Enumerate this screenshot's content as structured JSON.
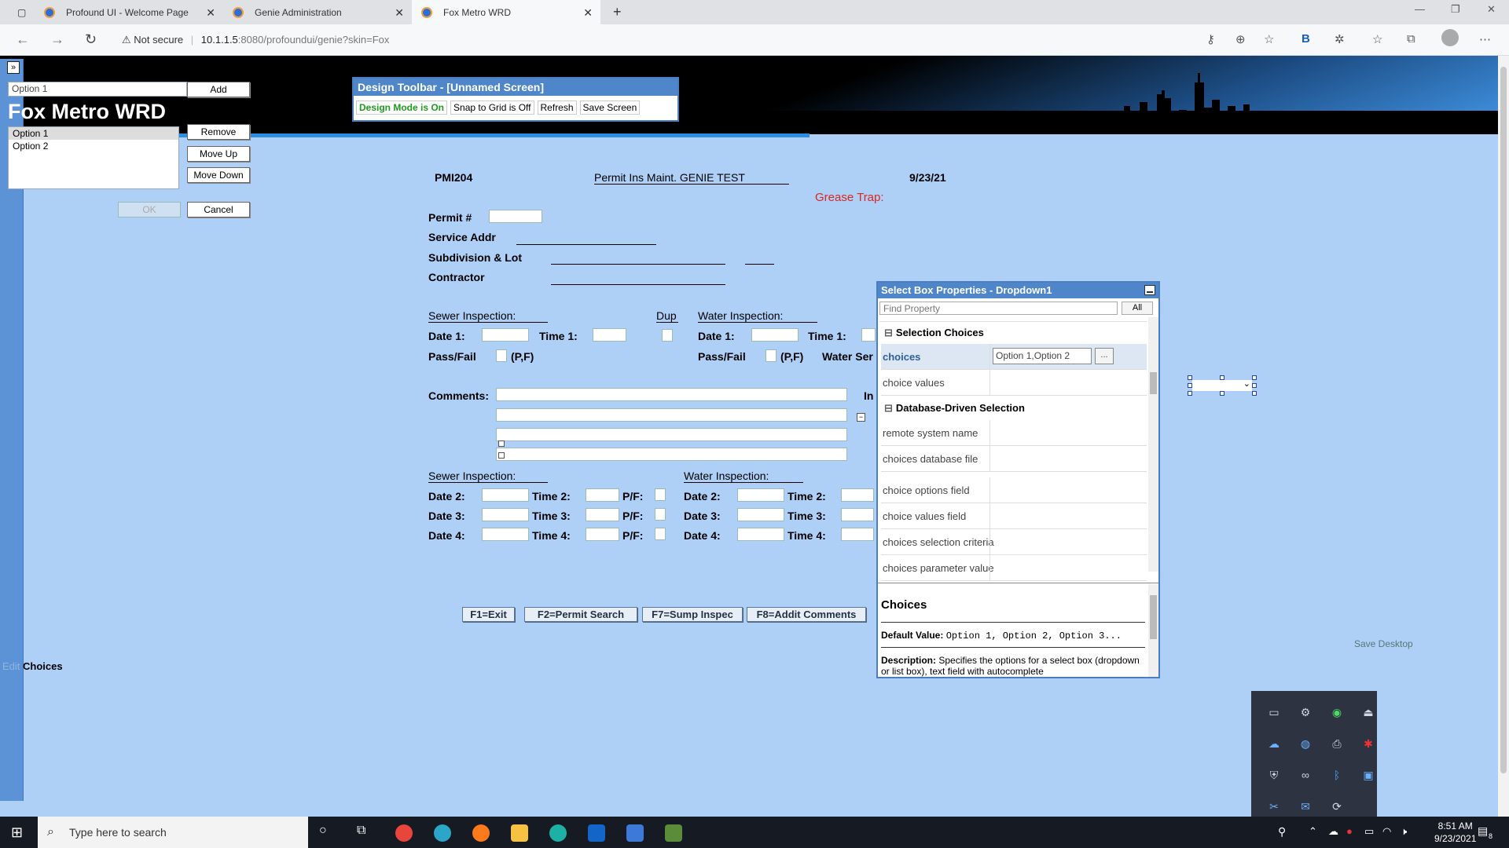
{
  "browser": {
    "tabs": [
      {
        "title": "Profound UI - Welcome Page"
      },
      {
        "title": "Genie Administration"
      },
      {
        "title": "Fox Metro WRD"
      }
    ],
    "new_tab": "+",
    "security": "Not secure",
    "url_host": "10.1.1.5",
    "url_path": ":8080/profoundui/genie?skin=Fox"
  },
  "app": {
    "brand": "Fox Metro WRD"
  },
  "choices_editor": {
    "input_value": "Option 1",
    "add": "Add",
    "items": [
      "Option 1",
      "Option 2"
    ],
    "remove": "Remove",
    "move_up": "Move Up",
    "move_down": "Move Down",
    "ok": "OK",
    "cancel": "Cancel",
    "edit_label": "Edit",
    "choices_label": "Choices"
  },
  "design_toolbar": {
    "title": "Design Toolbar - [Unnamed Screen]",
    "design_mode": "Design Mode is On",
    "snap": "Snap to Grid is Off",
    "refresh": "Refresh",
    "save": "Save Screen"
  },
  "form": {
    "program": "PMI204",
    "title": "Permit Ins Maint. GENIE TEST",
    "date": "9/23/21",
    "grease_trap": "Grease Trap:",
    "permit": "Permit #",
    "service_addr": "Service Addr",
    "subdivision": "Subdivision & Lot",
    "contractor": "Contractor",
    "sewer_inspection": "Sewer Inspection:",
    "dup": "Dup",
    "water_inspection": "Water Inspection:",
    "date1": "Date 1:",
    "time1": "Time 1:",
    "pass_fail": "Pass/Fail",
    "pf": "(P,F)",
    "water_ser": "Water Ser",
    "comments": "Comments:",
    "in_label": "In",
    "date2": "Date 2:",
    "time2": "Time 2:",
    "date3": "Date 3:",
    "time3": "Time 3:",
    "date4": "Date 4:",
    "time4": "Time 4:",
    "pf_colon": "P/F:",
    "fkeys": [
      "F1=Exit",
      "F2=Permit Search",
      "F7=Sump Inspec",
      "F8=Addit Comments"
    ]
  },
  "properties": {
    "title": "Select Box Properties - Dropdown1",
    "find_placeholder": "Find Property",
    "all": "All",
    "cat_selection": "Selection Choices",
    "choices_key": "choices",
    "choices_value": "Option 1,Option 2",
    "ellipsis": "...",
    "choice_values": "choice values",
    "cat_db": "Database-Driven Selection",
    "remote_system": "remote system name",
    "choices_db_file": "choices database file",
    "choice_options_field": "choice options field",
    "choice_values_field": "choice values field",
    "choices_selection_criteria": "choices selection criteria",
    "choices_parameter_value": "choices parameter value",
    "help_title": "Choices",
    "default_label": "Default Value:",
    "default_value": "Option 1, Option 2, Option 3...",
    "desc_label": "Description:",
    "desc_text": "Specifies the options for a select box (dropdown or list box), text field with autocomplete"
  },
  "save_desktop": "Save Desktop",
  "taskbar": {
    "search": "Type here to search",
    "time": "8:51 AM",
    "date": "9/23/2021",
    "notif": "8"
  },
  "colors": {
    "accent": "#4f86c9",
    "background": "#aed0f7",
    "grease": "#d9281f",
    "design_on": "#1f9b1f"
  }
}
